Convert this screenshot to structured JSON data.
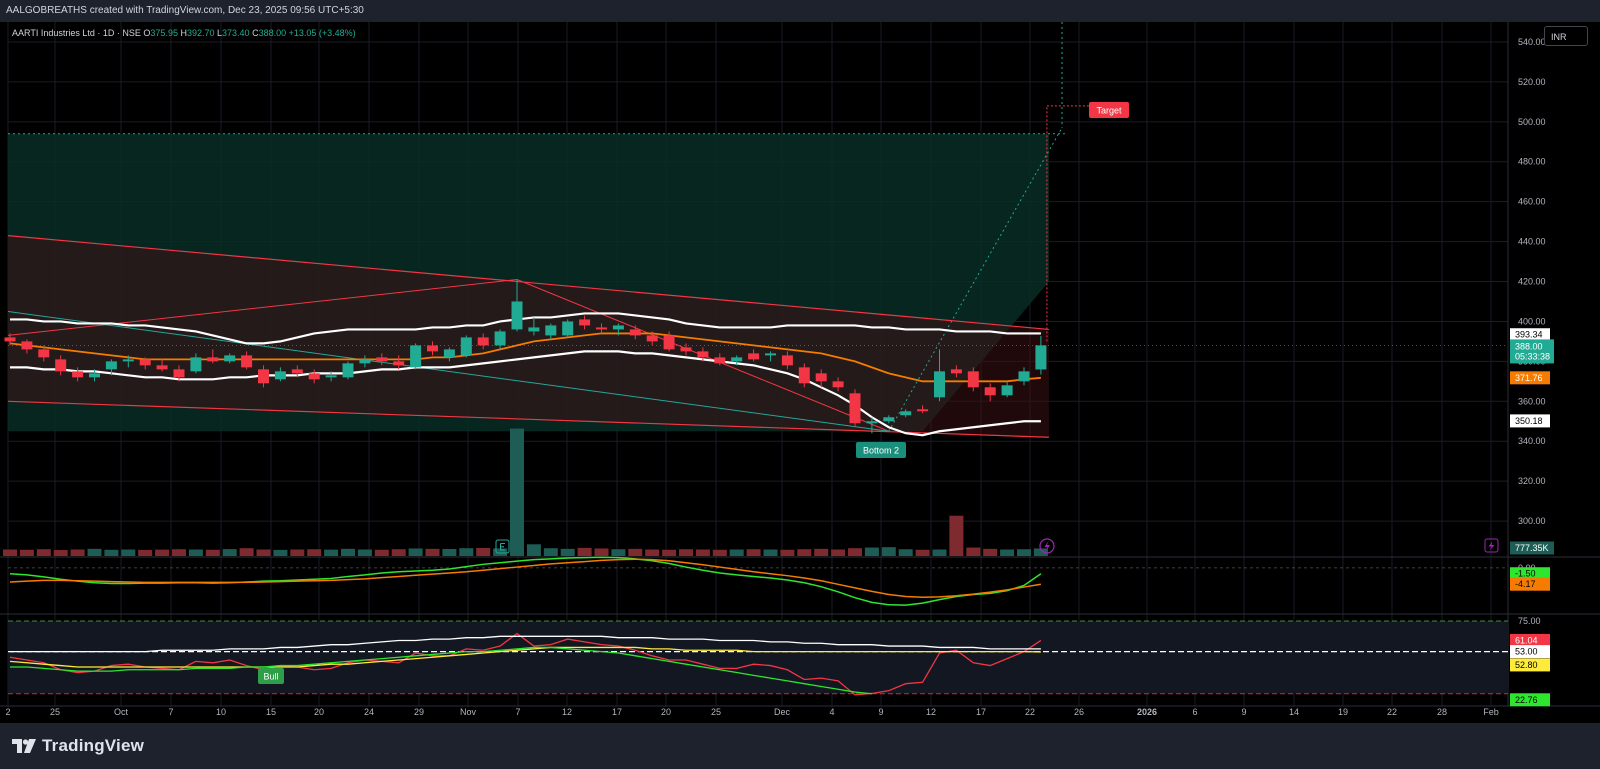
{
  "header": {
    "attribution": "AALGOBREATHS created with TradingView.com, Dec 23, 2025 09:56 UTC+5:30"
  },
  "legend": {
    "symbol": "AARTI Industries Ltd · 1D · NSE",
    "open_label": "O",
    "open": "375.95",
    "high_label": "H",
    "high": "392.70",
    "low_label": "L",
    "low": "373.40",
    "close_label": "C",
    "close": "388.00",
    "change": "+13.05 (+3.48%)"
  },
  "currency": "INR",
  "brand": {
    "name": "TradingView"
  },
  "colors": {
    "up": "#22ab94",
    "down": "#f23645",
    "background": "#000000",
    "panel": "#1e222d",
    "grid": "#1a1d26",
    "text": "#d1d4dc",
    "ema_orange": "#f57c00",
    "macd_green": "#2ee62e",
    "rsi_yellow": "#ffeb3b"
  },
  "chart_data": [
    {
      "type": "candlestick",
      "ylim": [
        282,
        550
      ],
      "yticks": [
        300,
        320,
        340,
        360,
        380,
        400,
        420,
        440,
        460,
        480,
        500,
        520,
        540
      ],
      "xticks": [
        "2",
        "25",
        "Oct",
        "7",
        "10",
        "15",
        "20",
        "24",
        "29",
        "Nov",
        "7",
        "12",
        "17",
        "20",
        "25",
        "Dec",
        "4",
        "9",
        "12",
        "17",
        "22",
        "26",
        "2026",
        "6",
        "9",
        "14",
        "19",
        "22",
        "28",
        "Feb"
      ],
      "candles": [
        {
          "o": 392,
          "h": 394,
          "l": 388,
          "c": 390
        },
        {
          "o": 390,
          "h": 391,
          "l": 384,
          "c": 386
        },
        {
          "o": 386,
          "h": 388,
          "l": 380,
          "c": 382
        },
        {
          "o": 381,
          "h": 383,
          "l": 373,
          "c": 375
        },
        {
          "o": 375,
          "h": 377,
          "l": 370,
          "c": 372
        },
        {
          "o": 372,
          "h": 376,
          "l": 370,
          "c": 374
        },
        {
          "o": 376,
          "h": 381,
          "l": 373,
          "c": 380
        },
        {
          "o": 380,
          "h": 383,
          "l": 377,
          "c": 381
        },
        {
          "o": 381,
          "h": 382,
          "l": 376,
          "c": 378
        },
        {
          "o": 378,
          "h": 381,
          "l": 375,
          "c": 376
        },
        {
          "o": 376,
          "h": 378,
          "l": 370,
          "c": 372
        },
        {
          "o": 375,
          "h": 384,
          "l": 374,
          "c": 382
        },
        {
          "o": 382,
          "h": 386,
          "l": 379,
          "c": 380
        },
        {
          "o": 380,
          "h": 384,
          "l": 379,
          "c": 383
        },
        {
          "o": 383,
          "h": 385,
          "l": 376,
          "c": 377
        },
        {
          "o": 376,
          "h": 378,
          "l": 367,
          "c": 369
        },
        {
          "o": 371,
          "h": 377,
          "l": 370,
          "c": 375
        },
        {
          "o": 376,
          "h": 378,
          "l": 372,
          "c": 374
        },
        {
          "o": 374,
          "h": 376,
          "l": 369,
          "c": 371
        },
        {
          "o": 372,
          "h": 375,
          "l": 370,
          "c": 373
        },
        {
          "o": 372,
          "h": 380,
          "l": 371,
          "c": 379
        },
        {
          "o": 379,
          "h": 383,
          "l": 377,
          "c": 381
        },
        {
          "o": 382,
          "h": 384,
          "l": 378,
          "c": 380
        },
        {
          "o": 380,
          "h": 383,
          "l": 376,
          "c": 378
        },
        {
          "o": 377,
          "h": 389,
          "l": 376,
          "c": 388
        },
        {
          "o": 388,
          "h": 390,
          "l": 383,
          "c": 385
        },
        {
          "o": 382,
          "h": 387,
          "l": 380,
          "c": 386
        },
        {
          "o": 383,
          "h": 393,
          "l": 382,
          "c": 392
        },
        {
          "o": 392,
          "h": 394,
          "l": 386,
          "c": 388
        },
        {
          "o": 388,
          "h": 396,
          "l": 386,
          "c": 395
        },
        {
          "o": 396,
          "h": 421,
          "l": 395,
          "c": 410
        },
        {
          "o": 395,
          "h": 402,
          "l": 393,
          "c": 397
        },
        {
          "o": 393,
          "h": 399,
          "l": 391,
          "c": 398
        },
        {
          "o": 393,
          "h": 401,
          "l": 392,
          "c": 400
        },
        {
          "o": 401,
          "h": 403,
          "l": 396,
          "c": 398
        },
        {
          "o": 397,
          "h": 399,
          "l": 394,
          "c": 396
        },
        {
          "o": 396,
          "h": 399,
          "l": 393,
          "c": 398
        },
        {
          "o": 396,
          "h": 398,
          "l": 391,
          "c": 393
        },
        {
          "o": 393,
          "h": 395,
          "l": 388,
          "c": 390
        },
        {
          "o": 393,
          "h": 395,
          "l": 385,
          "c": 386
        },
        {
          "o": 387,
          "h": 389,
          "l": 383,
          "c": 385
        },
        {
          "o": 385,
          "h": 387,
          "l": 380,
          "c": 382
        },
        {
          "o": 382,
          "h": 384,
          "l": 378,
          "c": 379
        },
        {
          "o": 380,
          "h": 383,
          "l": 378,
          "c": 382
        },
        {
          "o": 384,
          "h": 386,
          "l": 380,
          "c": 381
        },
        {
          "o": 383,
          "h": 385,
          "l": 380,
          "c": 384
        },
        {
          "o": 383,
          "h": 385,
          "l": 376,
          "c": 378
        },
        {
          "o": 377,
          "h": 379,
          "l": 367,
          "c": 369
        },
        {
          "o": 374,
          "h": 376,
          "l": 367,
          "c": 370
        },
        {
          "o": 370,
          "h": 372,
          "l": 365,
          "c": 367
        },
        {
          "o": 364,
          "h": 366,
          "l": 347,
          "c": 349
        },
        {
          "o": 349,
          "h": 352,
          "l": 344,
          "c": 350
        },
        {
          "o": 350,
          "h": 353,
          "l": 349,
          "c": 352
        },
        {
          "o": 353,
          "h": 356,
          "l": 352,
          "c": 355
        },
        {
          "o": 356,
          "h": 358,
          "l": 354,
          "c": 355
        },
        {
          "o": 362,
          "h": 386,
          "l": 360,
          "c": 375
        },
        {
          "o": 376,
          "h": 378,
          "l": 372,
          "c": 374
        },
        {
          "o": 375,
          "h": 377,
          "l": 365,
          "c": 367
        },
        {
          "o": 367,
          "h": 369,
          "l": 360,
          "c": 363
        },
        {
          "o": 363,
          "h": 370,
          "l": 362,
          "c": 368
        },
        {
          "o": 370,
          "h": 377,
          "l": 368,
          "c": 375
        },
        {
          "o": 375.95,
          "h": 392.7,
          "l": 373.4,
          "c": 388
        }
      ],
      "overlays": [
        {
          "name": "",
          "color": "#ffffff",
          "values": [
            401,
            401,
            400,
            400,
            399,
            399,
            399,
            398,
            398,
            397,
            396,
            395,
            393,
            391,
            389,
            389,
            390,
            392,
            394,
            395,
            396,
            396,
            396,
            396,
            396,
            397,
            397,
            398,
            398,
            400,
            401,
            402,
            402,
            403,
            404,
            404,
            404,
            403,
            402,
            401,
            399,
            398,
            397,
            397,
            397,
            397,
            398,
            398,
            398,
            398,
            398,
            397,
            397,
            396,
            396,
            396,
            395,
            395,
            395,
            394,
            394,
            394
          ]
        },
        {
          "name": "",
          "color": "#ffffff",
          "values": [
            377,
            377,
            376,
            376,
            375,
            375,
            374,
            373,
            372,
            372,
            371,
            371,
            371,
            372,
            372,
            373,
            373,
            373,
            374,
            374,
            374,
            375,
            376,
            376,
            377,
            377,
            377,
            378,
            379,
            380,
            381,
            382,
            383,
            384,
            385,
            385,
            385,
            384,
            384,
            383,
            382,
            381,
            380,
            379,
            378,
            376,
            374,
            371,
            367,
            363,
            358,
            352,
            347,
            344,
            343,
            345,
            346,
            347,
            348,
            349,
            350,
            350
          ]
        },
        {
          "name": "",
          "color": "#f57c00",
          "values": [
            389,
            388,
            387,
            386,
            385,
            384,
            383,
            382,
            381,
            381,
            381,
            381,
            381,
            381,
            381,
            381,
            381,
            381,
            381,
            381,
            381,
            381,
            381,
            381,
            381,
            382,
            382,
            383,
            384,
            386,
            388,
            390,
            391,
            392,
            393,
            394,
            394,
            394,
            394,
            393,
            392,
            391,
            390,
            389,
            388,
            387,
            386,
            385,
            384,
            382,
            380,
            377,
            374,
            372,
            370,
            370,
            370,
            370,
            370,
            370,
            371,
            371.76
          ]
        }
      ],
      "price_labels": [
        "393.34",
        "388.00",
        "05:33:38",
        "371.76",
        "350.18"
      ],
      "annotations": [
        "Target",
        "Bottom 2"
      ]
    },
    {
      "type": "bar",
      "name": "Volume",
      "label": "777.35K",
      "values": [
        50,
        48,
        52,
        46,
        50,
        55,
        48,
        50,
        47,
        49,
        52,
        50,
        48,
        53,
        60,
        50,
        47,
        50,
        52,
        49,
        55,
        50,
        48,
        52,
        58,
        55,
        54,
        60,
        62,
        58,
        980,
        90,
        60,
        55,
        62,
        58,
        52,
        55,
        50,
        48,
        52,
        50,
        48,
        50,
        52,
        50,
        48,
        52,
        55,
        50,
        60,
        65,
        68,
        52,
        48,
        50,
        310,
        65,
        55,
        50,
        52,
        58
      ]
    },
    {
      "type": "line",
      "name": "MACD",
      "ylim": [
        -11,
        2
      ],
      "yticks": [
        "0.00"
      ],
      "series": [
        {
          "name": "",
          "color": "#2ee62e",
          "values": [
            -1.5,
            -1.8,
            -2.3,
            -2.9,
            -3.4,
            -3.8,
            -4.0,
            -4.0,
            -3.9,
            -3.9,
            -3.8,
            -3.8,
            -3.9,
            -3.8,
            -3.6,
            -3.4,
            -3.3,
            -3.1,
            -2.9,
            -2.7,
            -2.2,
            -1.8,
            -1.3,
            -1.0,
            -0.8,
            -0.6,
            -0.3,
            0.3,
            0.9,
            1.3,
            1.7,
            2.1,
            2.3,
            2.5,
            2.6,
            2.7,
            2.6,
            2.3,
            1.8,
            1.1,
            0.2,
            -0.6,
            -1.3,
            -1.8,
            -2.2,
            -2.6,
            -3.1,
            -3.8,
            -4.8,
            -6.1,
            -7.6,
            -8.8,
            -9.4,
            -9.5,
            -9.0,
            -8.1,
            -7.3,
            -6.8,
            -6.5,
            -5.8,
            -4.5,
            -1.5
          ]
        },
        {
          "name": "",
          "color": "#f57c00",
          "values": [
            -3.6,
            -3.4,
            -3.2,
            -3.2,
            -3.3,
            -3.4,
            -3.5,
            -3.6,
            -3.7,
            -3.7,
            -3.7,
            -3.7,
            -3.7,
            -3.7,
            -3.7,
            -3.6,
            -3.5,
            -3.4,
            -3.3,
            -3.2,
            -3.0,
            -2.8,
            -2.5,
            -2.2,
            -1.9,
            -1.6,
            -1.3,
            -1.0,
            -0.6,
            -0.2,
            0.2,
            0.6,
            1.0,
            1.3,
            1.6,
            1.9,
            2.1,
            2.2,
            2.1,
            1.8,
            1.3,
            0.8,
            0.2,
            -0.4,
            -1.0,
            -1.5,
            -2.0,
            -2.6,
            -3.3,
            -4.2,
            -5.1,
            -6.0,
            -6.8,
            -7.3,
            -7.5,
            -7.4,
            -7.1,
            -6.7,
            -6.2,
            -5.6,
            -4.9,
            -4.17
          ]
        }
      ],
      "price_labels": [
        "-1.50",
        "-4.17"
      ]
    },
    {
      "type": "line",
      "name": "RSI",
      "ylim": [
        14,
        80
      ],
      "yticks": [
        "75.00",
        "53.00",
        "22.76"
      ],
      "series": [
        {
          "name": "",
          "color": "#f23645",
          "values": [
            49,
            47,
            45,
            40,
            38,
            39,
            43,
            44,
            42,
            41,
            40,
            46,
            45,
            47,
            43,
            40,
            43,
            42,
            40,
            41,
            45,
            47,
            46,
            45,
            52,
            50,
            50,
            55,
            54,
            57,
            66,
            57,
            58,
            62,
            60,
            58,
            57,
            54,
            50,
            47,
            47,
            44,
            41,
            41,
            44,
            43,
            40,
            33,
            34,
            32,
            22,
            23,
            25,
            30,
            31,
            52,
            54,
            45,
            43,
            48,
            53,
            61.04
          ]
        },
        {
          "name": "",
          "color": "#ffffff",
          "values": [
            53,
            53,
            53,
            53,
            53,
            53,
            53,
            53,
            53,
            54,
            54,
            54,
            54,
            55,
            55,
            55,
            56,
            56,
            57,
            58,
            58,
            59,
            60,
            61,
            61,
            62,
            62,
            63,
            63,
            64,
            64,
            64,
            64,
            64,
            64,
            64,
            63,
            63,
            63,
            62,
            62,
            62,
            61,
            61,
            61,
            60,
            60,
            59,
            59,
            58,
            58,
            58,
            57,
            57,
            57,
            56,
            56,
            56,
            55,
            55,
            55,
            55
          ]
        },
        {
          "name": "",
          "color": "#ffeb3b",
          "values": [
            46,
            45,
            44,
            43,
            42,
            42,
            42,
            42,
            42,
            42,
            42,
            42,
            42,
            42,
            42,
            42,
            42,
            42,
            43,
            44,
            44,
            45,
            46,
            47,
            48,
            49,
            50,
            51,
            52,
            53,
            54,
            55,
            56,
            56,
            56,
            56,
            56,
            56,
            55,
            55,
            54,
            54,
            54,
            54,
            53,
            53,
            53,
            53,
            53,
            53,
            53,
            53,
            53,
            53,
            53,
            53,
            53,
            53,
            53,
            53,
            53,
            52.8
          ]
        },
        {
          "name": "",
          "color": "#2ee62e",
          "values": [
            42,
            42,
            41,
            40,
            39,
            39,
            39,
            40,
            40,
            40,
            40,
            41,
            41,
            41,
            42,
            42,
            43,
            43,
            44,
            45,
            46,
            47,
            48,
            49,
            50,
            51,
            52,
            53,
            53,
            54,
            55,
            56,
            56,
            55,
            54,
            53,
            52,
            50,
            48,
            46,
            44,
            42,
            40,
            38,
            36,
            34,
            32,
            30,
            28,
            26,
            24,
            22.76
          ]
        }
      ],
      "price_labels": [
        "61.04",
        "53.00",
        "52.80",
        "22.76"
      ],
      "annotations": [
        "Bull"
      ]
    }
  ]
}
